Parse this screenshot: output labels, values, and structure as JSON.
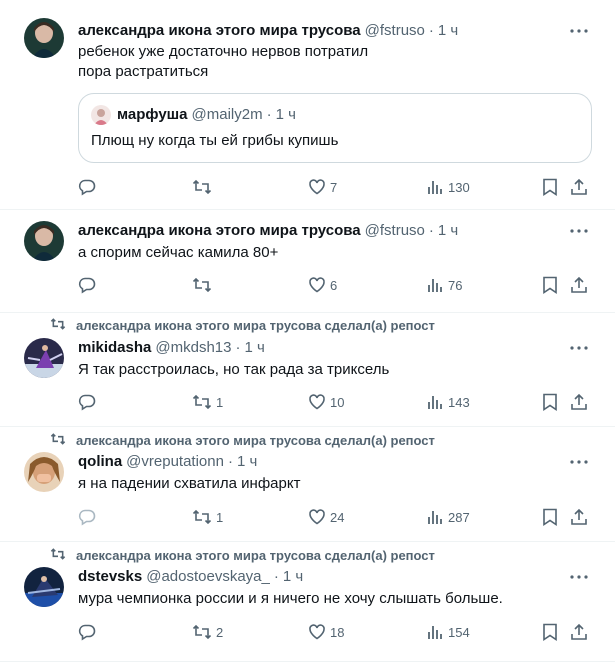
{
  "posts": [
    {
      "name": "александра икона этого мира трусова",
      "handle": "@fstruso",
      "time": "1 ч",
      "text": "ребенок уже достаточно нервов потратил\nпора растратиться",
      "quote": {
        "name": "марфуша",
        "handle": "@maily2m",
        "time": "1 ч",
        "text": "Плющ ну когда ты ей грибы купишь"
      },
      "replies": "",
      "reposts": "",
      "likes": "7",
      "views": "130"
    },
    {
      "name": "александра икона этого мира трусова",
      "handle": "@fstruso",
      "time": "1 ч",
      "text": "а спорим сейчас камила 80+",
      "replies": "",
      "reposts": "",
      "likes": "6",
      "views": "76"
    },
    {
      "repost_label": "александра икона этого мира трусова сделал(а) репост",
      "name": "mikidasha",
      "handle": "@mkdsh13",
      "time": "1 ч",
      "text": "Я так расстроилась, но так рада за триксель",
      "replies": "",
      "reposts": "1",
      "likes": "10",
      "views": "143"
    },
    {
      "repost_label": "александра икона этого мира трусова сделал(а) репост",
      "name": "qolina",
      "handle": "@vreputationn",
      "time": "1 ч",
      "text": "я на падении схватила инфаркт",
      "replies": "",
      "reposts": "1",
      "likes": "24",
      "views": "287"
    },
    {
      "repost_label": "александра икона этого мира трусова сделал(а) репост",
      "name": "dstevsks",
      "handle": "@adostoevskaya_",
      "time": "1 ч",
      "text": "мура чемпионка россии и я ничего не хочу слышать больше.",
      "replies": "",
      "reposts": "2",
      "likes": "18",
      "views": "154"
    }
  ],
  "separator": "·",
  "icons": {
    "more": "more-dots-icon",
    "reply": "reply-icon",
    "repost": "repost-icon",
    "like": "heart-icon",
    "views": "views-chart-icon",
    "bookmark": "bookmark-icon",
    "share": "share-icon"
  },
  "colors": {
    "text": "#0f1419",
    "muted": "#536471",
    "border": "#cfd9de",
    "divider": "#eff3f4"
  }
}
